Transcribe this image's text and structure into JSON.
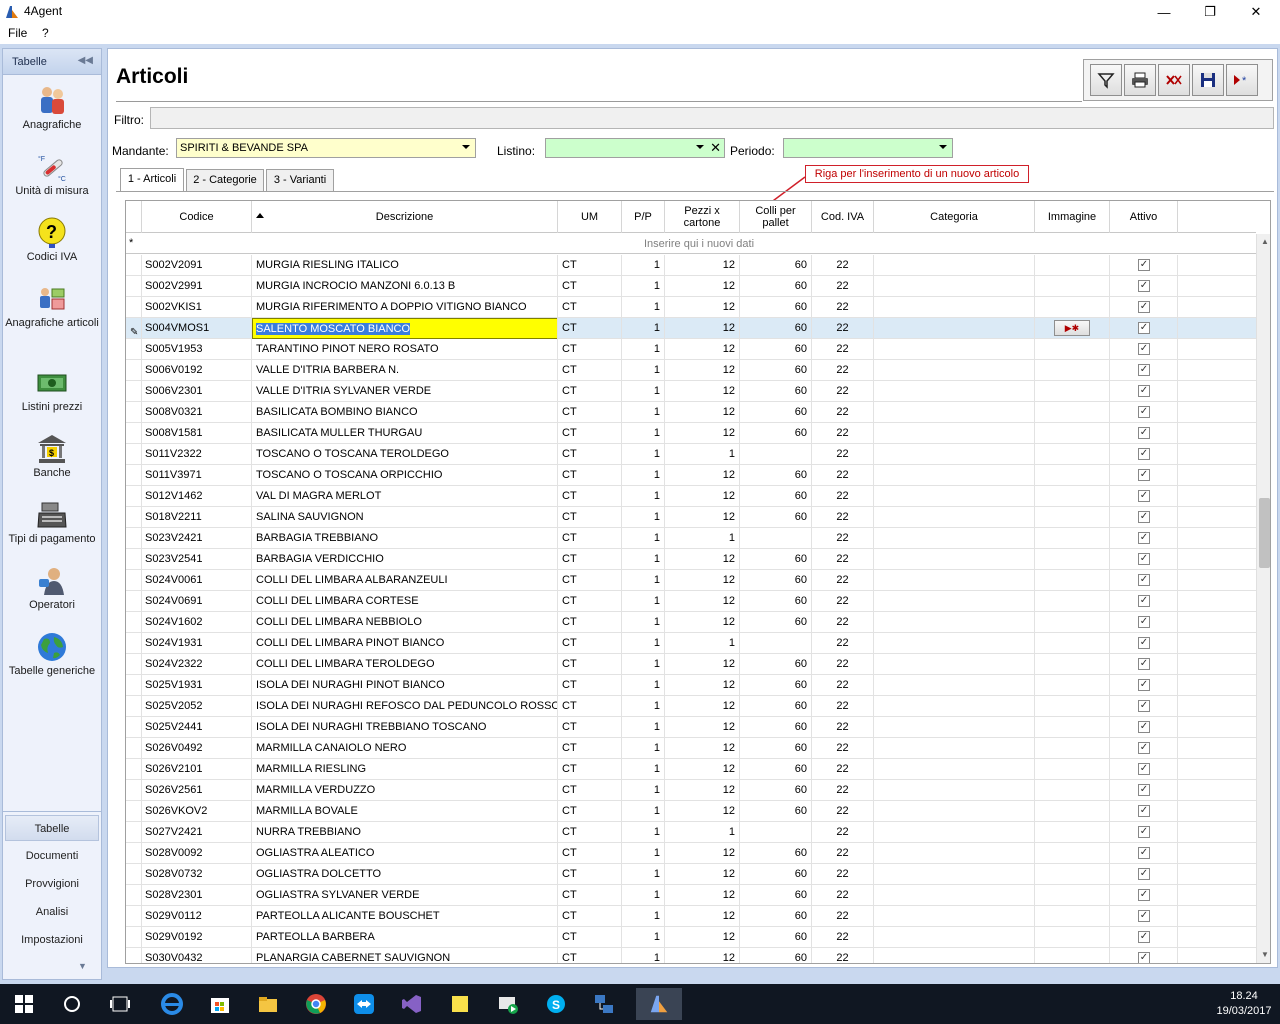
{
  "app": {
    "title": "4Agent"
  },
  "menu": {
    "file": "File",
    "help": "?"
  },
  "nav": {
    "header": "Tabelle",
    "items": [
      {
        "label": "Anagrafiche",
        "icon": "people-icon"
      },
      {
        "label": "Unità di misura",
        "icon": "thermometer-icon"
      },
      {
        "label": "Codici IVA",
        "icon": "question-icon"
      },
      {
        "label": "Anagrafiche articoli",
        "icon": "articles-icon"
      },
      {
        "label": "Listini prezzi",
        "icon": "price-list-icon"
      },
      {
        "label": "Banche",
        "icon": "bank-icon"
      },
      {
        "label": "Tipi di pagamento",
        "icon": "cash-register-icon"
      },
      {
        "label": "Operatori",
        "icon": "operator-icon"
      },
      {
        "label": "Tabelle generiche",
        "icon": "globe-icon"
      }
    ],
    "sections": [
      "Tabelle",
      "Documenti",
      "Provvigioni",
      "Analisi",
      "Impostazioni"
    ]
  },
  "page": {
    "title": "Articoli",
    "filter_label": "Filtro:",
    "mandante_label": "Mandante:",
    "mandante_value": "SPIRITI & BEVANDE SPA",
    "listino_label": "Listino:",
    "listino_value": "",
    "periodo_label": "Periodo:",
    "periodo_value": "",
    "callout": "Riga per l'inserimento di un nuovo articolo",
    "tabs": [
      "1 - Articoli",
      "2 - Categorie",
      "3 - Varianti"
    ]
  },
  "toolbar": [
    "filter-icon",
    "print-icon",
    "delete-icon",
    "save-icon",
    "new-record-icon"
  ],
  "grid": {
    "headers": {
      "codice": "Codice",
      "descrizione": "Descrizione",
      "um": "UM",
      "pp": "P/P",
      "pezzi_1": "Pezzi x",
      "pezzi_2": "cartone",
      "colli_1": "Colli per",
      "colli_2": "pallet",
      "iva": "Cod. IVA",
      "categoria": "Categoria",
      "immagine": "Immagine",
      "attivo": "Attivo"
    },
    "new_row_marker": "*",
    "new_row_hint": "Inserire qui i nuovi dati",
    "rows": [
      [
        "S002V2091",
        "MURGIA RIESLING ITALICO",
        "CT",
        "1",
        "12",
        "60",
        "22"
      ],
      [
        "S002V2991",
        "MURGIA INCROCIO MANZONI 6.0.13 B",
        "CT",
        "1",
        "12",
        "60",
        "22"
      ],
      [
        "S002VKIS1",
        "MURGIA RIFERIMENTO A DOPPIO VITIGNO BIANCO",
        "CT",
        "1",
        "12",
        "60",
        "22"
      ],
      [
        "S004VMOS1",
        "SALENTO MOSCATO BIANCO",
        "CT",
        "1",
        "12",
        "60",
        "22"
      ],
      [
        "S005V1953",
        "TARANTINO PINOT NERO ROSATO",
        "CT",
        "1",
        "12",
        "60",
        "22"
      ],
      [
        "S006V0192",
        "VALLE D'ITRIA BARBERA N.",
        "CT",
        "1",
        "12",
        "60",
        "22"
      ],
      [
        "S006V2301",
        "VALLE D'ITRIA SYLVANER VERDE",
        "CT",
        "1",
        "12",
        "60",
        "22"
      ],
      [
        "S008V0321",
        "BASILICATA  BOMBINO BIANCO",
        "CT",
        "1",
        "12",
        "60",
        "22"
      ],
      [
        "S008V1581",
        "BASILICATA  MULLER THURGAU",
        "CT",
        "1",
        "12",
        "60",
        "22"
      ],
      [
        "S011V2322",
        "TOSCANO O TOSCANA TEROLDEGO",
        "CT",
        "1",
        "1",
        "",
        "22"
      ],
      [
        "S011V3971",
        "TOSCANO O TOSCANA ORPICCHIO",
        "CT",
        "1",
        "12",
        "60",
        "22"
      ],
      [
        "S012V1462",
        "VAL DI MAGRA MERLOT",
        "CT",
        "1",
        "12",
        "60",
        "22"
      ],
      [
        "S018V2211",
        "SALINA SAUVIGNON",
        "CT",
        "1",
        "12",
        "60",
        "22"
      ],
      [
        "S023V2421",
        "BARBAGIA TREBBIANO",
        "CT",
        "1",
        "1",
        "",
        "22"
      ],
      [
        "S023V2541",
        "BARBAGIA VERDICCHIO",
        "CT",
        "1",
        "12",
        "60",
        "22"
      ],
      [
        "S024V0061",
        "COLLI DEL LIMBARA ALBARANZEULI",
        "CT",
        "1",
        "12",
        "60",
        "22"
      ],
      [
        "S024V0691",
        "COLLI DEL LIMBARA CORTESE",
        "CT",
        "1",
        "12",
        "60",
        "22"
      ],
      [
        "S024V1602",
        "COLLI DEL LIMBARA NEBBIOLO",
        "CT",
        "1",
        "12",
        "60",
        "22"
      ],
      [
        "S024V1931",
        "COLLI DEL LIMBARA PINOT BIANCO",
        "CT",
        "1",
        "1",
        "",
        "22"
      ],
      [
        "S024V2322",
        "COLLI DEL LIMBARA TEROLDEGO",
        "CT",
        "1",
        "12",
        "60",
        "22"
      ],
      [
        "S025V1931",
        "ISOLA DEI NURAGHI PINOT BIANCO",
        "CT",
        "1",
        "12",
        "60",
        "22"
      ],
      [
        "S025V2052",
        "ISOLA DEI NURAGHI REFOSCO DAL PEDUNCOLO ROSSO",
        "CT",
        "1",
        "12",
        "60",
        "22"
      ],
      [
        "S025V2441",
        "ISOLA DEI NURAGHI TREBBIANO TOSCANO",
        "CT",
        "1",
        "12",
        "60",
        "22"
      ],
      [
        "S026V0492",
        "MARMILLA CANAIOLO NERO",
        "CT",
        "1",
        "12",
        "60",
        "22"
      ],
      [
        "S026V2101",
        "MARMILLA RIESLING",
        "CT",
        "1",
        "12",
        "60",
        "22"
      ],
      [
        "S026V2561",
        "MARMILLA VERDUZZO",
        "CT",
        "1",
        "12",
        "60",
        "22"
      ],
      [
        "S026VKOV2",
        "MARMILLA BOVALE",
        "CT",
        "1",
        "12",
        "60",
        "22"
      ],
      [
        "S027V2421",
        "NURRA TREBBIANO",
        "CT",
        "1",
        "1",
        "",
        "22"
      ],
      [
        "S028V0092",
        "OGLIASTRA ALEATICO",
        "CT",
        "1",
        "12",
        "60",
        "22"
      ],
      [
        "S028V0732",
        "OGLIASTRA DOLCETTO",
        "CT",
        "1",
        "12",
        "60",
        "22"
      ],
      [
        "S028V2301",
        "OGLIASTRA SYLVANER VERDE",
        "CT",
        "1",
        "12",
        "60",
        "22"
      ],
      [
        "S029V0112",
        "PARTEOLLA ALICANTE BOUSCHET",
        "CT",
        "1",
        "12",
        "60",
        "22"
      ],
      [
        "S029V0192",
        "PARTEOLLA BARBERA",
        "CT",
        "1",
        "12",
        "60",
        "22"
      ],
      [
        "S030V0432",
        "PLANARGIA CABERNET SAUVIGNON",
        "CT",
        "1",
        "12",
        "60",
        "22"
      ]
    ],
    "current_row": 3,
    "attivo_checked": true
  },
  "taskbar": {
    "time": "18.24",
    "date": "19/03/2017"
  },
  "colors": {
    "frame": "#c9d8ef",
    "mandante_bg": "#ffffcc",
    "listino_bg": "#ccffcc",
    "edit_bg": "#ffff00",
    "callout": "#d0202a"
  }
}
